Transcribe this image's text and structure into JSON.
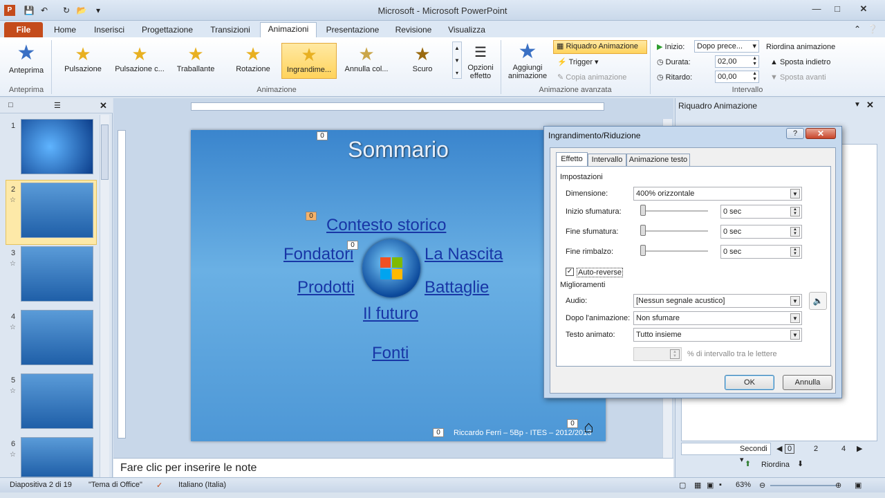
{
  "window": {
    "title": "Microsoft  -  Microsoft PowerPoint"
  },
  "tabs": {
    "file": "File",
    "items": [
      "Home",
      "Inserisci",
      "Progettazione",
      "Transizioni",
      "Animazioni",
      "Presentazione",
      "Revisione",
      "Visualizza"
    ],
    "active": "Animazioni"
  },
  "ribbon": {
    "preview": {
      "label": "Anteprima",
      "group": "Anteprima"
    },
    "animations": [
      "Pulsazione",
      "Pulsazione c...",
      "Traballante",
      "Rotazione",
      "Ingrandime...",
      "Annulla col...",
      "Scuro"
    ],
    "effect_options": "Opzioni effetto",
    "animation_group": "Animazione",
    "add_animation": "Aggiungi animazione",
    "animation_pane": "Riquadro Animazione",
    "trigger": "Trigger",
    "copy_animation": "Copia animazione",
    "advanced_group": "Animazione avanzata",
    "start_label": "Inizio:",
    "start_value": "Dopo prece...",
    "duration_label": "Durata:",
    "duration_value": "02,00",
    "delay_label": "Ritardo:",
    "delay_value": "00,00",
    "timing_group": "Intervallo",
    "reorder_title": "Riordina animazione",
    "move_earlier": "Sposta indietro",
    "move_later": "Sposta avanti"
  },
  "thumbnails": {
    "numbers": [
      "1",
      "2",
      "3",
      "4",
      "5",
      "6"
    ],
    "selected": "2"
  },
  "slide": {
    "title": "Sommario",
    "links": [
      "Contesto storico",
      "Fondatori",
      "La Nascita",
      "Prodotti",
      "Battaglie",
      "Il futuro",
      "Fonti"
    ],
    "footer": "Riccardo Ferri – 5Bp - ITES – 2012/2013",
    "badges": [
      "0",
      "0",
      "0",
      "0",
      "0"
    ]
  },
  "notes": {
    "placeholder": "Fare clic per inserire le note"
  },
  "right_pane": {
    "title": "Riquadro Animazione",
    "seconds_label": "Secondi",
    "timeline": [
      "0",
      "2",
      "4"
    ],
    "reorder": "Riordina"
  },
  "dialog": {
    "title": "Ingrandimento/Riduzione",
    "tabs": [
      "Effetto",
      "Intervallo",
      "Animazione testo"
    ],
    "settings_header": "Impostazioni",
    "size_label": "Dimensione:",
    "size_value": "400% orizzontale",
    "smooth_start_label": "Inizio sfumatura:",
    "smooth_start_value": "0 sec",
    "smooth_end_label": "Fine sfumatura:",
    "smooth_end_value": "0 sec",
    "bounce_end_label": "Fine rimbalzo:",
    "bounce_end_value": "0 sec",
    "autoreverse": "Auto-reverse",
    "enhancements_header": "Miglioramenti",
    "sound_label": "Audio:",
    "sound_value": "[Nessun segnale acustico]",
    "after_label": "Dopo l'animazione:",
    "after_value": "Non sfumare",
    "text_label": "Testo animato:",
    "text_value": "Tutto insieme",
    "letter_delay": "% di intervallo tra le lettere",
    "ok": "OK",
    "cancel": "Annulla"
  },
  "status": {
    "slide": "Diapositiva 2 di 19",
    "theme": "\"Tema di Office\"",
    "language": "Italiano (Italia)",
    "zoom": "63%"
  },
  "colors": {
    "accent": "#c44b1b",
    "link": "#1836a6",
    "ribbon": "#dce7f4"
  }
}
